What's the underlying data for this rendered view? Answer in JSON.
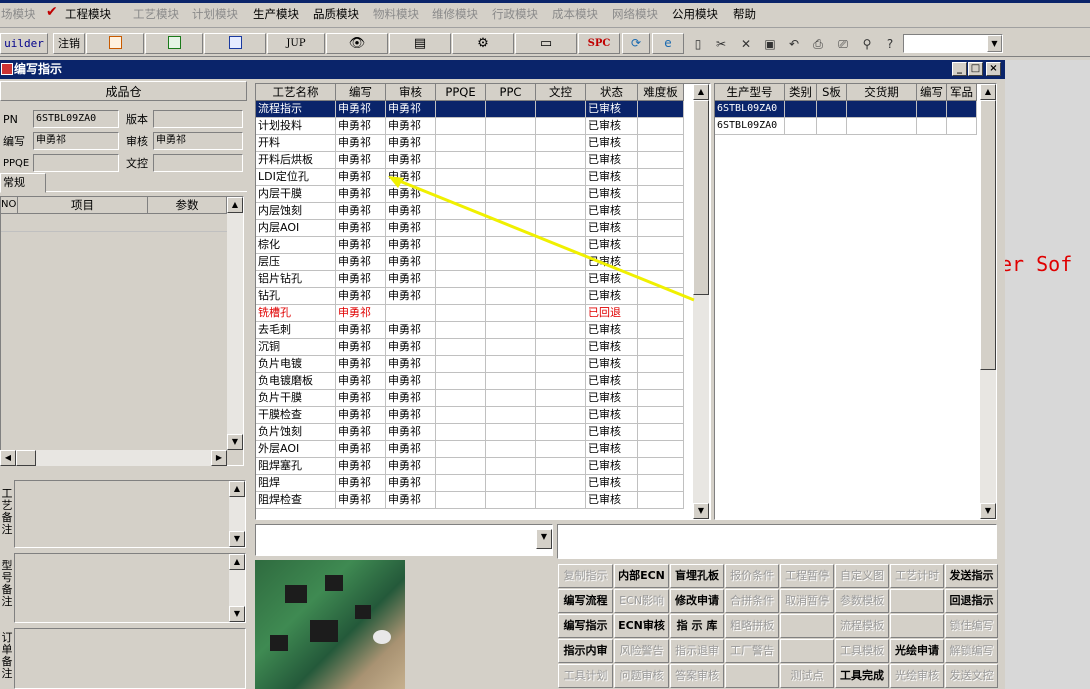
{
  "menu": [
    {
      "label": "场模块",
      "enabled": false
    },
    {
      "label": "工程模块",
      "enabled": true
    },
    {
      "label": "工艺模块",
      "enabled": false
    },
    {
      "label": "计划模块",
      "enabled": false
    },
    {
      "label": "生产模块",
      "enabled": true
    },
    {
      "label": "品质模块",
      "enabled": true
    },
    {
      "label": "物料模块",
      "enabled": false
    },
    {
      "label": "维修模块",
      "enabled": false
    },
    {
      "label": "行政模块",
      "enabled": false
    },
    {
      "label": "成本模块",
      "enabled": false
    },
    {
      "label": "网络模块",
      "enabled": false
    },
    {
      "label": "公用模块",
      "enabled": true
    },
    {
      "label": "帮助",
      "enabled": true
    }
  ],
  "toolbar": {
    "builder": "uilder",
    "logout": "注销",
    "jup": "JUP",
    "spc": "SPC"
  },
  "window": {
    "title": "编写指示"
  },
  "left": {
    "warehouse": "成品仓",
    "pn_label": "PN",
    "pn_value": "6STBL09ZA0",
    "version_label": "版本",
    "version_value": "",
    "writer_label": "编写",
    "writer_value": "申勇祁",
    "review_label": "审核",
    "review_value": "申勇祁",
    "ppqe_label": "PPQE",
    "ppqe_value": "",
    "doc_label": "文控",
    "doc_value": "",
    "tab": "常规",
    "cols": [
      "NO",
      "项目",
      "参数"
    ],
    "note1": "工艺备注",
    "note2": "型号备注",
    "note3": "订单备注"
  },
  "main_grid": {
    "headers": [
      "工艺名称",
      "编写",
      "审核",
      "PPQE",
      "PPC",
      "文控",
      "状态",
      "难度板"
    ],
    "rows": [
      [
        "流程指示",
        "申勇祁",
        "申勇祁",
        "",
        "",
        "",
        "已审核",
        ""
      ],
      [
        "计划投料",
        "申勇祁",
        "申勇祁",
        "",
        "",
        "",
        "已审核",
        ""
      ],
      [
        "开料",
        "申勇祁",
        "申勇祁",
        "",
        "",
        "",
        "已审核",
        ""
      ],
      [
        "开料后烘板",
        "申勇祁",
        "申勇祁",
        "",
        "",
        "",
        "已审核",
        ""
      ],
      [
        "LDI定位孔",
        "申勇祁",
        "申勇祁",
        "",
        "",
        "",
        "已审核",
        ""
      ],
      [
        "内层干膜",
        "申勇祁",
        "申勇祁",
        "",
        "",
        "",
        "已审核",
        ""
      ],
      [
        "内层蚀刻",
        "申勇祁",
        "申勇祁",
        "",
        "",
        "",
        "已审核",
        ""
      ],
      [
        "内层AOI",
        "申勇祁",
        "申勇祁",
        "",
        "",
        "",
        "已审核",
        ""
      ],
      [
        "棕化",
        "申勇祁",
        "申勇祁",
        "",
        "",
        "",
        "已审核",
        ""
      ],
      [
        "层压",
        "申勇祁",
        "申勇祁",
        "",
        "",
        "",
        "已审核",
        ""
      ],
      [
        "铝片钻孔",
        "申勇祁",
        "申勇祁",
        "",
        "",
        "",
        "已审核",
        ""
      ],
      [
        "钻孔",
        "申勇祁",
        "申勇祁",
        "",
        "",
        "",
        "已审核",
        ""
      ],
      [
        "铣槽孔",
        "申勇祁",
        "",
        "",
        "",
        "",
        "已回退",
        ""
      ],
      [
        "去毛刺",
        "申勇祁",
        "申勇祁",
        "",
        "",
        "",
        "已审核",
        ""
      ],
      [
        "沉铜",
        "申勇祁",
        "申勇祁",
        "",
        "",
        "",
        "已审核",
        ""
      ],
      [
        "负片电镀",
        "申勇祁",
        "申勇祁",
        "",
        "",
        "",
        "已审核",
        ""
      ],
      [
        "负电镀磨板",
        "申勇祁",
        "申勇祁",
        "",
        "",
        "",
        "已审核",
        ""
      ],
      [
        "负片干膜",
        "申勇祁",
        "申勇祁",
        "",
        "",
        "",
        "已审核",
        ""
      ],
      [
        "干膜检查",
        "申勇祁",
        "申勇祁",
        "",
        "",
        "",
        "已审核",
        ""
      ],
      [
        "负片蚀刻",
        "申勇祁",
        "申勇祁",
        "",
        "",
        "",
        "已审核",
        ""
      ],
      [
        "外层AOI",
        "申勇祁",
        "申勇祁",
        "",
        "",
        "",
        "已审核",
        ""
      ],
      [
        "阻焊塞孔",
        "申勇祁",
        "申勇祁",
        "",
        "",
        "",
        "已审核",
        ""
      ],
      [
        "阻焊",
        "申勇祁",
        "申勇祁",
        "",
        "",
        "",
        "已审核",
        ""
      ],
      [
        "阻焊检查",
        "申勇祁",
        "申勇祁",
        "",
        "",
        "",
        "已审核",
        ""
      ]
    ]
  },
  "right_grid": {
    "headers": [
      "生产型号",
      "类别",
      "S板",
      "交货期",
      "编写",
      "军品"
    ],
    "rows": [
      [
        "6STBL09ZA0",
        "",
        "",
        "",
        "",
        ""
      ],
      [
        "6STBL09ZA0",
        "",
        "",
        "",
        "",
        ""
      ]
    ]
  },
  "actions": [
    [
      {
        "label": "复制指示",
        "enabled": false
      },
      {
        "label": "内部ECN",
        "enabled": true
      },
      {
        "label": "盲埋孔板",
        "enabled": true
      },
      {
        "label": "报价条件",
        "enabled": false
      },
      {
        "label": "工程暂停",
        "enabled": false
      },
      {
        "label": "自定义图",
        "enabled": false
      },
      {
        "label": "工艺计时",
        "enabled": false
      },
      {
        "label": "发送指示",
        "enabled": true
      }
    ],
    [
      {
        "label": "编写流程",
        "enabled": true
      },
      {
        "label": "ECN影响",
        "enabled": false
      },
      {
        "label": "修改申请",
        "enabled": true
      },
      {
        "label": "合拼条件",
        "enabled": false
      },
      {
        "label": "取消暂停",
        "enabled": false
      },
      {
        "label": "参数模板",
        "enabled": false
      },
      {
        "label": "",
        "enabled": false
      },
      {
        "label": "回退指示",
        "enabled": true
      }
    ],
    [
      {
        "label": "编写指示",
        "enabled": true
      },
      {
        "label": "ECN审核",
        "enabled": true
      },
      {
        "label": "指 示 库",
        "enabled": true
      },
      {
        "label": "粗略拼板",
        "enabled": false
      },
      {
        "label": "",
        "enabled": false
      },
      {
        "label": "流程模板",
        "enabled": false
      },
      {
        "label": "",
        "enabled": false
      },
      {
        "label": "锁住编写",
        "enabled": false
      }
    ],
    [
      {
        "label": "指示内审",
        "enabled": true
      },
      {
        "label": "风险警告",
        "enabled": false
      },
      {
        "label": "指示退审",
        "enabled": false
      },
      {
        "label": "工厂警告",
        "enabled": false
      },
      {
        "label": "",
        "enabled": false
      },
      {
        "label": "工具模板",
        "enabled": false
      },
      {
        "label": "光绘申请",
        "enabled": true
      },
      {
        "label": "解锁编写",
        "enabled": false
      }
    ],
    [
      {
        "label": "工具计划",
        "enabled": false
      },
      {
        "label": "问题审核",
        "enabled": false
      },
      {
        "label": "答案审核",
        "enabled": false
      },
      {
        "label": "",
        "enabled": false
      },
      {
        "label": "测试点",
        "enabled": false
      },
      {
        "label": "工具完成",
        "enabled": true
      },
      {
        "label": "光绘审核",
        "enabled": false
      },
      {
        "label": "发送文控",
        "enabled": false
      }
    ]
  ],
  "bg_text": "er Sof"
}
